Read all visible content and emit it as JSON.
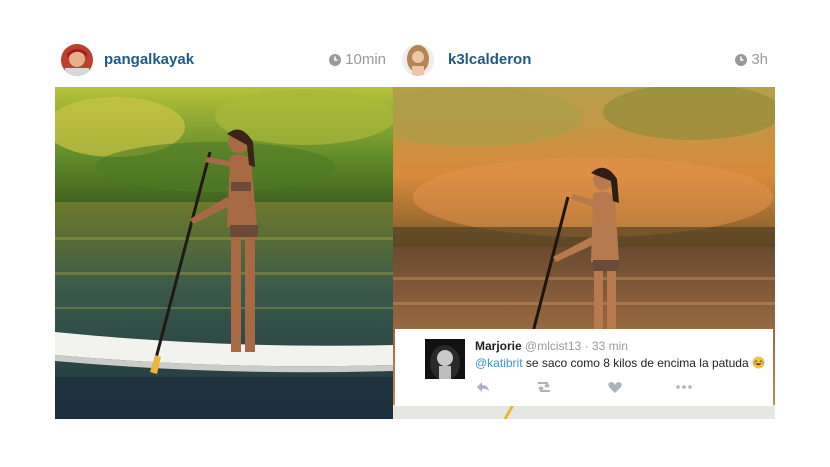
{
  "posts": [
    {
      "username": "pangalkayak",
      "time": "10min"
    },
    {
      "username": "k3lcalderon",
      "time": "3h"
    }
  ],
  "tweet": {
    "name": "Marjorie",
    "handle": "@mlcist13",
    "separator": "·",
    "time": "33 min",
    "mention": "@katibrit",
    "text": " se saco como 8 kilos de encima la patuda "
  }
}
